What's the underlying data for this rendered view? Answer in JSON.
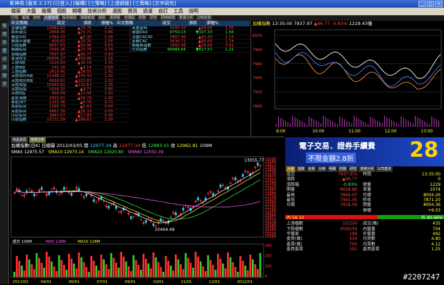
{
  "titlebar": {
    "title": "影神鳥 [版本 2.17] [已登入] [報價] [三策略] [上證超級] [三策略] [文字研究]"
  },
  "menubar": [
    "檔案",
    "大盤",
    "報價",
    "個股",
    "期權",
    "技術分析",
    "選股",
    "資訊",
    "過濾",
    "自訂",
    "工具",
    "說明"
  ],
  "tabs": [
    "行情",
    "報價",
    "技術",
    "大盤指標",
    "股票期貨",
    "期權報價",
    "期貨",
    "選擇權",
    "自選股",
    "財務",
    "研究",
    "即時新聞",
    "量價分析",
    "分時走勢"
  ],
  "leftbar": [
    "報",
    "價",
    "表",
    "圖",
    "技",
    "選",
    "期",
    "資"
  ],
  "quote": {
    "headers": [
      "中文簡稱",
      "成交",
      "漲跌",
      "漲幅%"
    ],
    "left": [
      [
        "道瓊指數",
        "12962.81",
        "▲14.76",
        "0.11"
      ],
      [
        "那斯達克",
        "2958.45",
        "▲25.71",
        "0.86"
      ],
      [
        "標普500",
        "1364.33",
        "▲5.30",
        "0.39"
      ],
      [
        "費城半導體",
        "409.61",
        "▲10.70",
        "2.55"
      ],
      [
        "日經指數",
        "9637.63",
        "▲60.96",
        "0.63"
      ],
      [
        "韓國綜合",
        "2000.36",
        "▲15.79",
        "0.79"
      ],
      [
        "加權指數",
        "7937.97",
        "▲66.77",
        "0.83"
      ],
      [
        "香港恆生",
        "20806.27",
        "▲459.86",
        "2.16"
      ],
      [
        "上證A股",
        "2524.93",
        "▲36.16",
        "1.41"
      ],
      [
        "上證B股",
        "241.29",
        "▲4.14",
        "0.69"
      ],
      [
        "上證指數",
        "2410.45",
        "▲34.55",
        "1.41"
      ],
      [
        "深證成份A股",
        "11048.22",
        "▲145.43",
        "1.30"
      ],
      [
        "深證成份B股",
        "4918.81",
        "▲101.65",
        "2.02"
      ],
      [
        "深證成指",
        "10093.81",
        "▲132.63",
        "1.30"
      ],
      [
        "深證綜指",
        "1016.32",
        "▲9.71",
        "0.95"
      ],
      [
        "深證B指",
        "666.69",
        "▲12.99",
        "1.91"
      ],
      [
        "星股海峽",
        "2932.01",
        "▲59.79",
        "2.00"
      ],
      [
        "泰股SET",
        "1153.36",
        "▲6.79",
        "0.71"
      ],
      [
        "馬股綜合",
        "1580.73",
        "▲0.69",
        "0.04"
      ],
      [
        "菲股綜合",
        "4967.39",
        "▲26.33",
        "0.53"
      ],
      [
        "印尼綜合",
        "3967.07",
        "▲17.83",
        "0.45"
      ],
      [
        "印度指數",
        "17171.39",
        "▲189.61",
        "1.09"
      ]
    ],
    "right": [
      [
        "英國富時",
        "4295.50",
        "▲58.66",
        "1.35"
      ],
      [
        "德國DAX",
        "6759.15",
        "▼107.33",
        "1.56"
      ],
      [
        "法國CAC40",
        "5807.40",
        "▲62.43",
        "1.15"
      ],
      [
        "金融CAC",
        "3436.71",
        "▲60.83",
        "1.74"
      ],
      [
        "俄羅斯指數",
        "1692.49",
        "▲59.68",
        "3.41"
      ],
      [
        "巴西指數",
        "66984.65",
        "▼817.57",
        "1.21"
      ]
    ]
  },
  "intraday": {
    "title": "加權指數",
    "time": "13:35:00",
    "price": "7937.97",
    "change": "▲66.77",
    "pct": "-0.83%",
    "vol": "1229.43億",
    "yticks": [
      "8000",
      "7980",
      "7960",
      "7945",
      "7905",
      "7885"
    ],
    "xticks": [
      "9:00",
      "10:00",
      "11:00",
      "12:00",
      "13:00"
    ]
  },
  "kchart": {
    "tabs": [
      "商品資訊",
      "技術分析"
    ],
    "name": "加權指數(日K)",
    "period": "日線圖",
    "date": "2012/03/05",
    "labels": [
      "開",
      "高",
      "低",
      "收"
    ],
    "open": "12977.34",
    "high": "12977.34",
    "low": "12883.01",
    "close": "12962.81",
    "vol": "109M",
    "sma": [
      {
        "label": "SMA5",
        "value": "12975.57",
        "color": "#ffffff"
      },
      {
        "label": "SMA10",
        "value": "12973.14",
        "color": "#ffff40"
      },
      {
        "label": "SMA20",
        "value": "12920.80",
        "color": "#40ff40"
      },
      {
        "label": "SMA60",
        "value": "12550.39",
        "color": "#ff60ff"
      }
    ],
    "yticks": [
      "13390",
      "13184",
      "13072",
      "12960",
      "12848",
      "12736",
      "12624",
      "12512",
      "12400",
      "12288",
      "12176",
      "12064",
      "11952",
      "11840",
      "11728",
      "11616",
      "11504",
      "11392",
      "11280",
      "11168",
      "11056",
      "10944",
      "10832",
      "10720",
      "10608",
      "10496",
      "10384",
      "10272",
      "10160",
      "10048"
    ],
    "hi_label": "13055.77",
    "lo_label": "10404.49",
    "vol_leg": {
      "vol": "成交 109M",
      "ma5": "MA5 128M",
      "ma10": "MA10 128M"
    },
    "vol_yticks": [
      "300",
      "200",
      "100",
      "0"
    ],
    "xticks": [
      "2011/02",
      "04/01",
      "06/01",
      "07/01",
      "09/01",
      "10/01",
      "11/01",
      "12/01",
      "2012/01"
    ]
  },
  "banner": {
    "line1": "電子交易．證券手續費",
    "line2": "不限金額2.8折",
    "big": "28",
    "bg": "#0a1f73"
  },
  "detail": {
    "tabs": [
      "大盤",
      "指數",
      "走勢",
      "分時",
      "明細",
      "財務",
      "研究",
      "技術分析",
      "公司基本"
    ],
    "rows": [
      [
        "成交",
        "7937.97s",
        "時間",
        "13:35:00"
      ],
      [
        "漲跌",
        "▲66.77",
        "",
        "0"
      ],
      [
        "漲跌幅",
        "-0.83%",
        "總量",
        "1229"
      ],
      [
        "開盤",
        "8028.86",
        "單量",
        "1074"
      ],
      [
        "最高",
        "7860.07",
        "均價",
        "8004.26"
      ],
      [
        "最低",
        "7941.05",
        "昨收",
        "7871.20"
      ],
      [
        "均價",
        "7918.59",
        "開盤",
        "8004.36"
      ],
      [
        "",
        "",
        "振幅",
        "+8.03"
      ]
    ],
    "bar": {
      "left": "內 58.10",
      "right": "外 40.46%",
      "pct": 58.1
    },
    "rows2": [
      [
        "上漲檔數",
        "1015/0",
        "成交(萬)",
        "435"
      ],
      [
        "下跌檔數",
        "3595/54",
        "內盤量",
        "704"
      ],
      [
        "平盤家",
        "199",
        "外盤量",
        "492"
      ],
      [
        "委買(萬)",
        "554",
        "均買數",
        "4.80"
      ],
      [
        "委賣(萬)",
        "763",
        "均賣數",
        "4.12"
      ],
      [
        "委買委賣",
        "191",
        "委買委賣",
        "1.25"
      ]
    ]
  },
  "watermark": "#2207247"
}
